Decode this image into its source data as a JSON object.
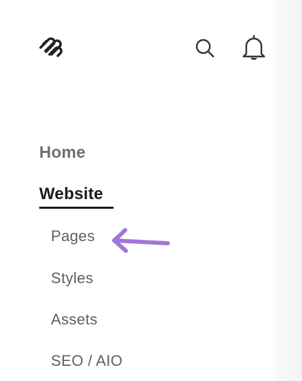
{
  "header": {
    "logo_icon": "squarespace-logo-icon",
    "search_icon": "search-icon",
    "notifications_icon": "bell-icon"
  },
  "nav": {
    "items": [
      {
        "label": "Home",
        "active": false
      },
      {
        "label": "Website",
        "active": true
      }
    ],
    "website_subitems": [
      {
        "label": "Pages"
      },
      {
        "label": "Styles"
      },
      {
        "label": "Assets"
      },
      {
        "label": "SEO / AIO"
      }
    ]
  },
  "annotation": {
    "arrow_icon": "arrow-left-icon",
    "color": "#a276d9"
  },
  "colors": {
    "text_dark": "#1c1c1c",
    "text_muted": "#707070",
    "subitem_text": "#5f5f5f"
  }
}
